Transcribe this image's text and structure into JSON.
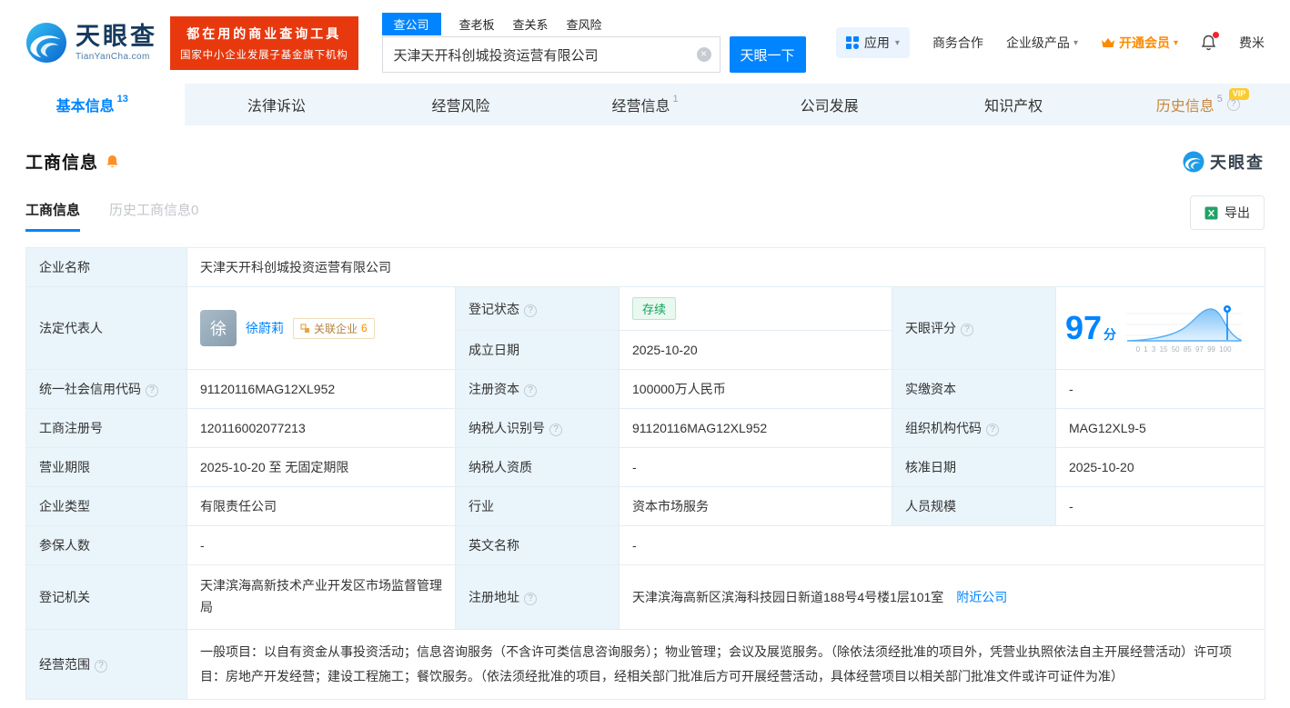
{
  "header": {
    "logo": {
      "brand": "天眼查",
      "domain": "TianYanCha.com"
    },
    "banner": {
      "line1": "都在用的商业查询工具",
      "line2": "国家中小企业发展子基金旗下机构"
    },
    "search": {
      "tabs": [
        "查公司",
        "查老板",
        "查关系",
        "查风险"
      ],
      "active_tab": "查公司",
      "input_value": "天津天开科创城投资运营有限公司",
      "search_button": "天眼一下"
    },
    "nav": {
      "apps": "应用",
      "cooperation": "商务合作",
      "enterprise_products": "企业级产品",
      "vip": "开通会员",
      "username": "费米"
    }
  },
  "tabs": [
    {
      "label": "基本信息",
      "count": "13",
      "active": true
    },
    {
      "label": "法律诉讼",
      "count": "",
      "active": false
    },
    {
      "label": "经营风险",
      "count": "",
      "active": false
    },
    {
      "label": "经营信息",
      "count": "1",
      "active": false
    },
    {
      "label": "公司发展",
      "count": "",
      "active": false
    },
    {
      "label": "知识产权",
      "count": "",
      "active": false
    },
    {
      "label": "历史信息",
      "count": "5",
      "active": false,
      "vip": true
    }
  ],
  "badges": {
    "vip": "VIP"
  },
  "icons": {
    "caret_down": "▾",
    "clear": "×",
    "help": "?"
  },
  "section": {
    "title": "工商信息",
    "watermark_brand": "天眼查",
    "subtab_active": "工商信息",
    "subtab_inactive": "历史工商信息0",
    "export_button": "导出"
  },
  "fields": {
    "company_name": {
      "label": "企业名称",
      "value": "天津天开科创城投资运营有限公司"
    },
    "legal_rep": {
      "label": "法定代表人",
      "avatar_char": "徐",
      "name": "徐蔚莉",
      "related_label": "关联企业",
      "related_count": "6"
    },
    "reg_status": {
      "label": "登记状态",
      "value": "存续"
    },
    "establish_date": {
      "label": "成立日期",
      "value": "2025-10-20"
    },
    "score": {
      "label": "天眼评分",
      "value": "97",
      "unit": "分",
      "axis_labels": "0 1 3 15 50 85 97 99 100"
    },
    "credit_code": {
      "label": "统一社会信用代码",
      "value": "91120116MAG12XL952"
    },
    "reg_capital": {
      "label": "注册资本",
      "value": "100000万人民币"
    },
    "paid_capital": {
      "label": "实缴资本",
      "value": "-"
    },
    "reg_number": {
      "label": "工商注册号",
      "value": "120116002077213"
    },
    "taxpayer_id": {
      "label": "纳税人识别号",
      "value": "91120116MAG12XL952"
    },
    "org_code": {
      "label": "组织机构代码",
      "value": "MAG12XL9-5"
    },
    "business_term": {
      "label": "营业期限",
      "value": "2025-10-20 至 无固定期限"
    },
    "taxpayer_quality": {
      "label": "纳税人资质",
      "value": "-"
    },
    "approval_date": {
      "label": "核准日期",
      "value": "2025-10-20"
    },
    "company_type": {
      "label": "企业类型",
      "value": "有限责任公司"
    },
    "industry": {
      "label": "行业",
      "value": "资本市场服务"
    },
    "staff_size": {
      "label": "人员规模",
      "value": "-"
    },
    "insured_count": {
      "label": "参保人数",
      "value": "-"
    },
    "english_name": {
      "label": "英文名称",
      "value": "-"
    },
    "reg_authority": {
      "label": "登记机关",
      "value": "天津滨海高新技术产业开发区市场监督管理局"
    },
    "reg_address": {
      "label": "注册地址",
      "value": "天津滨海高新区滨海科技园日新道188号4号楼1层101室",
      "nearby_link": "附近公司"
    },
    "business_scope": {
      "label": "经营范围",
      "value": "一般项目：以自有资金从事投资活动；信息咨询服务（不含许可类信息咨询服务）；物业管理；会议及展览服务。（除依法须经批准的项目外，凭营业执照依法自主开展经营活动）许可项目：房地产开发经营；建设工程施工；餐饮服务。（依法须经批准的项目，经相关部门批准后方可开展经营活动，具体经营项目以相关部门批准文件或许可证件为准）"
    }
  },
  "colors": {
    "brand_blue": "#0084ff",
    "banner_red": "#e8390e",
    "status_green": "#10a35c",
    "member_orange": "#ff8a00",
    "history_gold": "#c8873d",
    "vip_tag_gold": "#fccb2f",
    "label_cell_bg": "#e9f4fb"
  }
}
